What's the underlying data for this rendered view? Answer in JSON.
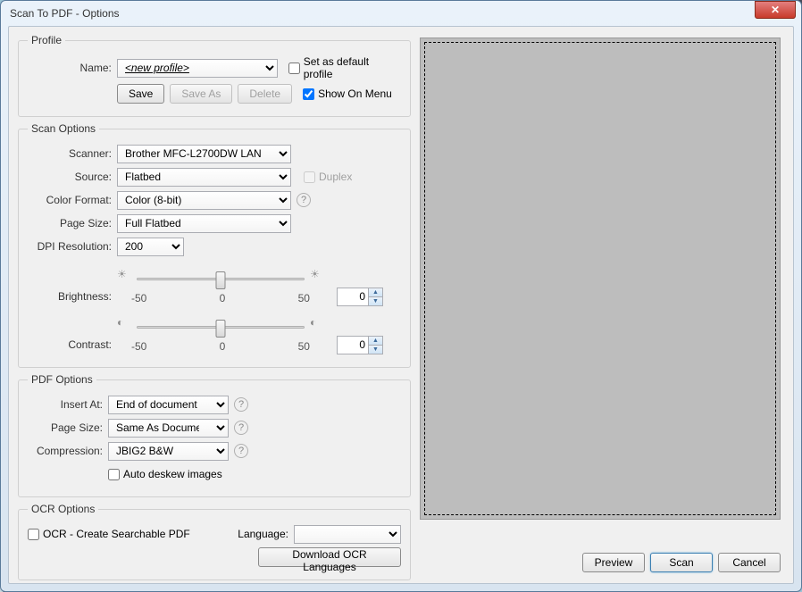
{
  "window": {
    "title": "Scan To PDF - Options"
  },
  "profile": {
    "legend": "Profile",
    "name_label": "Name:",
    "name_value": "<new profile>",
    "default_label": "Set as default profile",
    "default_checked": false,
    "save": "Save",
    "save_as": "Save As",
    "delete": "Delete",
    "show_menu_label": "Show On Menu",
    "show_menu_checked": true
  },
  "scan": {
    "legend": "Scan Options",
    "scanner_label": "Scanner:",
    "scanner_value": "Brother MFC-L2700DW LAN",
    "source_label": "Source:",
    "source_value": "Flatbed",
    "duplex_label": "Duplex",
    "colorfmt_label": "Color Format:",
    "colorfmt_value": "Color (8-bit)",
    "pagesize_label": "Page Size:",
    "pagesize_value": "Full Flatbed",
    "dpi_label": "DPI Resolution:",
    "dpi_value": "200",
    "brightness_label": "Brightness:",
    "brightness_min": "-50",
    "brightness_mid": "0",
    "brightness_max": "50",
    "brightness_value": "0",
    "contrast_label": "Contrast:",
    "contrast_min": "-50",
    "contrast_mid": "0",
    "contrast_max": "50",
    "contrast_value": "0"
  },
  "pdf": {
    "legend": "PDF Options",
    "insert_label": "Insert At:",
    "insert_value": "End of document",
    "pagesize_label": "Page Size:",
    "pagesize_value": "Same As Document",
    "compression_label": "Compression:",
    "compression_value": "JBIG2 B&W",
    "autodeskew_label": "Auto deskew images"
  },
  "ocr": {
    "legend": "OCR Options",
    "enable_label": "OCR - Create Searchable PDF",
    "language_label": "Language:",
    "language_value": "",
    "download": "Download OCR Languages"
  },
  "buttons": {
    "preview": "Preview",
    "scan": "Scan",
    "cancel": "Cancel"
  }
}
